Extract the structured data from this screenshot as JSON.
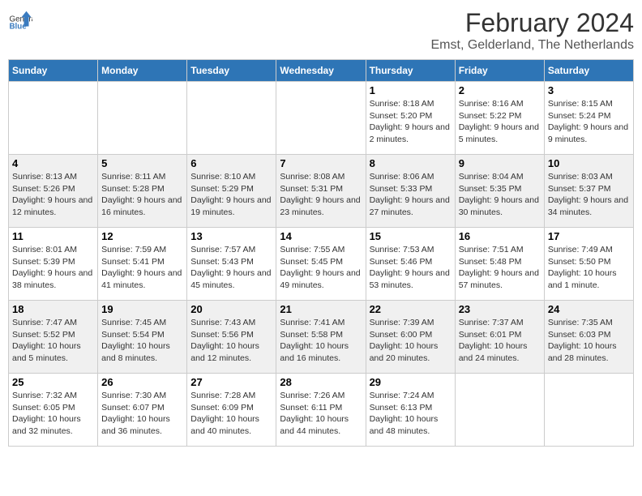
{
  "logo": {
    "text_general": "General",
    "text_blue": "Blue"
  },
  "title": "February 2024",
  "subtitle": "Emst, Gelderland, The Netherlands",
  "days_of_week": [
    "Sunday",
    "Monday",
    "Tuesday",
    "Wednesday",
    "Thursday",
    "Friday",
    "Saturday"
  ],
  "weeks": [
    [
      {
        "day": "",
        "sunrise": "",
        "sunset": "",
        "daylight": ""
      },
      {
        "day": "",
        "sunrise": "",
        "sunset": "",
        "daylight": ""
      },
      {
        "day": "",
        "sunrise": "",
        "sunset": "",
        "daylight": ""
      },
      {
        "day": "",
        "sunrise": "",
        "sunset": "",
        "daylight": ""
      },
      {
        "day": "1",
        "sunrise": "Sunrise: 8:18 AM",
        "sunset": "Sunset: 5:20 PM",
        "daylight": "Daylight: 9 hours and 2 minutes."
      },
      {
        "day": "2",
        "sunrise": "Sunrise: 8:16 AM",
        "sunset": "Sunset: 5:22 PM",
        "daylight": "Daylight: 9 hours and 5 minutes."
      },
      {
        "day": "3",
        "sunrise": "Sunrise: 8:15 AM",
        "sunset": "Sunset: 5:24 PM",
        "daylight": "Daylight: 9 hours and 9 minutes."
      }
    ],
    [
      {
        "day": "4",
        "sunrise": "Sunrise: 8:13 AM",
        "sunset": "Sunset: 5:26 PM",
        "daylight": "Daylight: 9 hours and 12 minutes."
      },
      {
        "day": "5",
        "sunrise": "Sunrise: 8:11 AM",
        "sunset": "Sunset: 5:28 PM",
        "daylight": "Daylight: 9 hours and 16 minutes."
      },
      {
        "day": "6",
        "sunrise": "Sunrise: 8:10 AM",
        "sunset": "Sunset: 5:29 PM",
        "daylight": "Daylight: 9 hours and 19 minutes."
      },
      {
        "day": "7",
        "sunrise": "Sunrise: 8:08 AM",
        "sunset": "Sunset: 5:31 PM",
        "daylight": "Daylight: 9 hours and 23 minutes."
      },
      {
        "day": "8",
        "sunrise": "Sunrise: 8:06 AM",
        "sunset": "Sunset: 5:33 PM",
        "daylight": "Daylight: 9 hours and 27 minutes."
      },
      {
        "day": "9",
        "sunrise": "Sunrise: 8:04 AM",
        "sunset": "Sunset: 5:35 PM",
        "daylight": "Daylight: 9 hours and 30 minutes."
      },
      {
        "day": "10",
        "sunrise": "Sunrise: 8:03 AM",
        "sunset": "Sunset: 5:37 PM",
        "daylight": "Daylight: 9 hours and 34 minutes."
      }
    ],
    [
      {
        "day": "11",
        "sunrise": "Sunrise: 8:01 AM",
        "sunset": "Sunset: 5:39 PM",
        "daylight": "Daylight: 9 hours and 38 minutes."
      },
      {
        "day": "12",
        "sunrise": "Sunrise: 7:59 AM",
        "sunset": "Sunset: 5:41 PM",
        "daylight": "Daylight: 9 hours and 41 minutes."
      },
      {
        "day": "13",
        "sunrise": "Sunrise: 7:57 AM",
        "sunset": "Sunset: 5:43 PM",
        "daylight": "Daylight: 9 hours and 45 minutes."
      },
      {
        "day": "14",
        "sunrise": "Sunrise: 7:55 AM",
        "sunset": "Sunset: 5:45 PM",
        "daylight": "Daylight: 9 hours and 49 minutes."
      },
      {
        "day": "15",
        "sunrise": "Sunrise: 7:53 AM",
        "sunset": "Sunset: 5:46 PM",
        "daylight": "Daylight: 9 hours and 53 minutes."
      },
      {
        "day": "16",
        "sunrise": "Sunrise: 7:51 AM",
        "sunset": "Sunset: 5:48 PM",
        "daylight": "Daylight: 9 hours and 57 minutes."
      },
      {
        "day": "17",
        "sunrise": "Sunrise: 7:49 AM",
        "sunset": "Sunset: 5:50 PM",
        "daylight": "Daylight: 10 hours and 1 minute."
      }
    ],
    [
      {
        "day": "18",
        "sunrise": "Sunrise: 7:47 AM",
        "sunset": "Sunset: 5:52 PM",
        "daylight": "Daylight: 10 hours and 5 minutes."
      },
      {
        "day": "19",
        "sunrise": "Sunrise: 7:45 AM",
        "sunset": "Sunset: 5:54 PM",
        "daylight": "Daylight: 10 hours and 8 minutes."
      },
      {
        "day": "20",
        "sunrise": "Sunrise: 7:43 AM",
        "sunset": "Sunset: 5:56 PM",
        "daylight": "Daylight: 10 hours and 12 minutes."
      },
      {
        "day": "21",
        "sunrise": "Sunrise: 7:41 AM",
        "sunset": "Sunset: 5:58 PM",
        "daylight": "Daylight: 10 hours and 16 minutes."
      },
      {
        "day": "22",
        "sunrise": "Sunrise: 7:39 AM",
        "sunset": "Sunset: 6:00 PM",
        "daylight": "Daylight: 10 hours and 20 minutes."
      },
      {
        "day": "23",
        "sunrise": "Sunrise: 7:37 AM",
        "sunset": "Sunset: 6:01 PM",
        "daylight": "Daylight: 10 hours and 24 minutes."
      },
      {
        "day": "24",
        "sunrise": "Sunrise: 7:35 AM",
        "sunset": "Sunset: 6:03 PM",
        "daylight": "Daylight: 10 hours and 28 minutes."
      }
    ],
    [
      {
        "day": "25",
        "sunrise": "Sunrise: 7:32 AM",
        "sunset": "Sunset: 6:05 PM",
        "daylight": "Daylight: 10 hours and 32 minutes."
      },
      {
        "day": "26",
        "sunrise": "Sunrise: 7:30 AM",
        "sunset": "Sunset: 6:07 PM",
        "daylight": "Daylight: 10 hours and 36 minutes."
      },
      {
        "day": "27",
        "sunrise": "Sunrise: 7:28 AM",
        "sunset": "Sunset: 6:09 PM",
        "daylight": "Daylight: 10 hours and 40 minutes."
      },
      {
        "day": "28",
        "sunrise": "Sunrise: 7:26 AM",
        "sunset": "Sunset: 6:11 PM",
        "daylight": "Daylight: 10 hours and 44 minutes."
      },
      {
        "day": "29",
        "sunrise": "Sunrise: 7:24 AM",
        "sunset": "Sunset: 6:13 PM",
        "daylight": "Daylight: 10 hours and 48 minutes."
      },
      {
        "day": "",
        "sunrise": "",
        "sunset": "",
        "daylight": ""
      },
      {
        "day": "",
        "sunrise": "",
        "sunset": "",
        "daylight": ""
      }
    ]
  ]
}
